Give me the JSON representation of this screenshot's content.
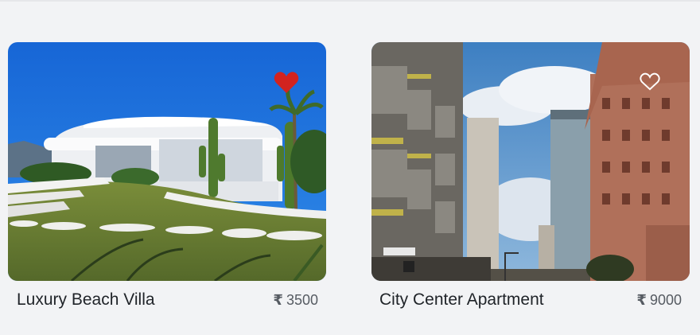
{
  "listings": [
    {
      "title": "Luxury Beach Villa",
      "currency_symbol": "₹",
      "price": "3500",
      "favorite": true,
      "favorite_icon": "heart-filled-icon",
      "favorite_color": "#d2231f"
    },
    {
      "title": "City Center Apartment",
      "currency_symbol": "₹",
      "price": "9000",
      "favorite": false,
      "favorite_icon": "heart-outline-icon",
      "favorite_color": "#ffffff"
    }
  ]
}
